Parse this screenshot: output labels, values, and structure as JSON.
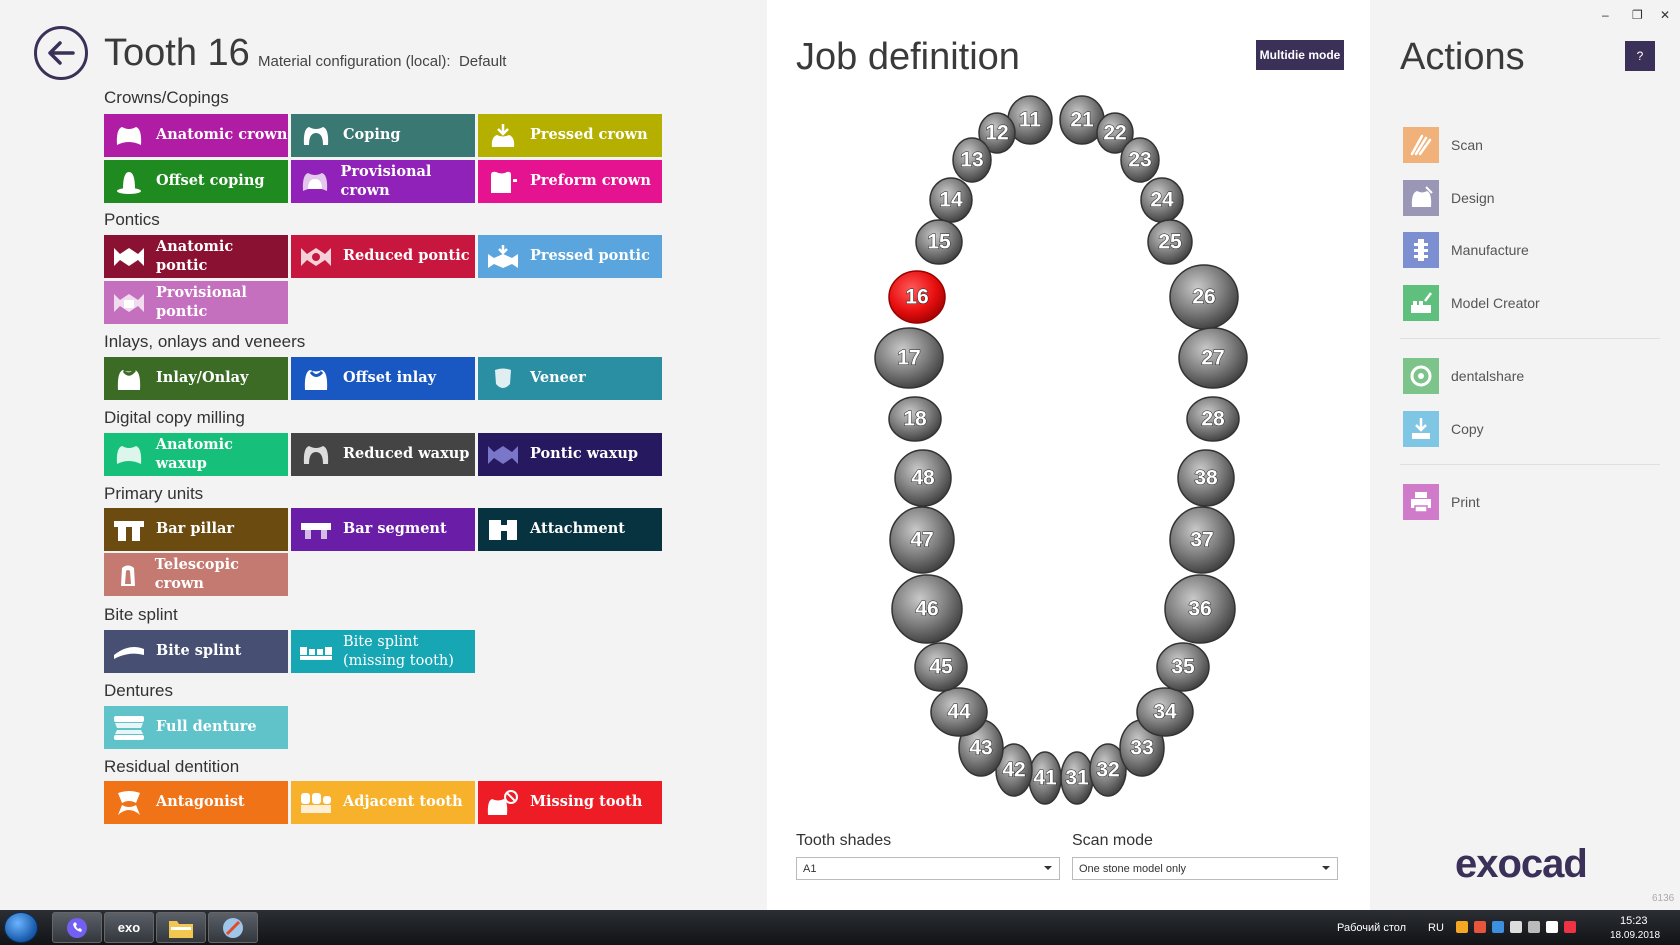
{
  "header": {
    "title": "Tooth 16",
    "material_label": "Material configuration (local):",
    "material_value": "Default"
  },
  "sections": {
    "crowns": "Crowns/Copings",
    "pontics": "Pontics",
    "inlays": "Inlays, onlays and veneers",
    "digital": "Digital copy milling",
    "primary": "Primary units",
    "bite": "Bite splint",
    "dentures": "Dentures",
    "residual": "Residual dentition"
  },
  "tiles": {
    "anatomic_crown": {
      "label": "Anatomic crown",
      "color": "#b11ca4"
    },
    "coping": {
      "label": "Coping",
      "color": "#3a7873"
    },
    "pressed_crown": {
      "label": "Pressed crown",
      "color": "#b5b000"
    },
    "offset_coping": {
      "label": "Offset coping",
      "color": "#1f8a1f"
    },
    "provisional_crown": {
      "label": "Provisional crown",
      "color": "#9122b9"
    },
    "preform_crown": {
      "label": "Preform crown",
      "color": "#e5138f"
    },
    "anatomic_pontic": {
      "label": "Anatomic pontic",
      "color": "#8b1132"
    },
    "reduced_pontic": {
      "label": "Reduced pontic",
      "color": "#c8173e"
    },
    "pressed_pontic": {
      "label": "Pressed pontic",
      "color": "#5ba5de"
    },
    "provisional_pontic": {
      "label": "Provisional pontic",
      "color": "#c570bf"
    },
    "inlay_onlay": {
      "label": "Inlay/Onlay",
      "color": "#3b6b25"
    },
    "offset_inlay": {
      "label": "Offset inlay",
      "color": "#1957c2"
    },
    "veneer": {
      "label": "Veneer",
      "color": "#2b8fa3"
    },
    "anatomic_waxup": {
      "label": "Anatomic waxup",
      "color": "#16c07a"
    },
    "reduced_waxup": {
      "label": "Reduced waxup",
      "color": "#444444"
    },
    "pontic_waxup": {
      "label": "Pontic waxup",
      "color": "#26195f"
    },
    "bar_pillar": {
      "label": "Bar pillar",
      "color": "#6b4b0f"
    },
    "bar_segment": {
      "label": "Bar segment",
      "color": "#6a1da6"
    },
    "attachment": {
      "label": "Attachment",
      "color": "#07323f"
    },
    "telescopic_crown": {
      "label": "Telescopic crown",
      "color": "#c47a71"
    },
    "bite_splint": {
      "label": "Bite splint",
      "color": "#474f72"
    },
    "bite_splint_missing_1": {
      "label": "Bite splint",
      "color": "#17a6b4"
    },
    "bite_splint_missing_2": {
      "label": "(missing tooth)"
    },
    "full_denture": {
      "label": "Full denture",
      "color": "#5fc3c9"
    },
    "antagonist": {
      "label": "Antagonist",
      "color": "#f07318"
    },
    "adjacent_tooth": {
      "label": "Adjacent tooth",
      "color": "#f7b12b"
    },
    "missing_tooth": {
      "label": "Missing tooth",
      "color": "#ee1d25"
    }
  },
  "job": {
    "title": "Job definition",
    "multidie_label": "Multidie mode",
    "selected_tooth": "16",
    "selected_color": "#e81010",
    "teeth": [
      "11",
      "12",
      "13",
      "14",
      "15",
      "16",
      "17",
      "18",
      "21",
      "22",
      "23",
      "24",
      "25",
      "26",
      "27",
      "28",
      "31",
      "32",
      "33",
      "34",
      "35",
      "36",
      "37",
      "38",
      "41",
      "42",
      "43",
      "44",
      "45",
      "46",
      "47",
      "48"
    ]
  },
  "shades": {
    "label": "Tooth shades",
    "value": "A1"
  },
  "scan_mode": {
    "label": "Scan mode",
    "value": "One stone model only"
  },
  "actions": {
    "title": "Actions",
    "help": "?",
    "items": [
      {
        "label": "Scan",
        "icon": "scan-icon",
        "color": "#f0b27a"
      },
      {
        "label": "Design",
        "icon": "design-icon",
        "color": "#9a97b6"
      },
      {
        "label": "Manufacture",
        "icon": "manufacture-icon",
        "color": "#7b8fd1"
      },
      {
        "label": "Model Creator",
        "icon": "model-creator-icon",
        "color": "#5fbf7d"
      },
      {
        "label": "dentalshare",
        "icon": "dentalshare-icon",
        "color": "#7cc489"
      },
      {
        "label": "Copy",
        "icon": "copy-icon",
        "color": "#7ec6e3"
      },
      {
        "label": "Print",
        "icon": "print-icon",
        "color": "#d07bc9"
      }
    ],
    "logo": "exocad",
    "build": "6136"
  },
  "window": {
    "minimize": "–",
    "restore": "❐",
    "close": "✕"
  },
  "taskbar": {
    "app_label": "exo",
    "desktop_label": "Рабочий стол",
    "lang": "RU",
    "time": "15:23",
    "date": "18.09.2018"
  }
}
